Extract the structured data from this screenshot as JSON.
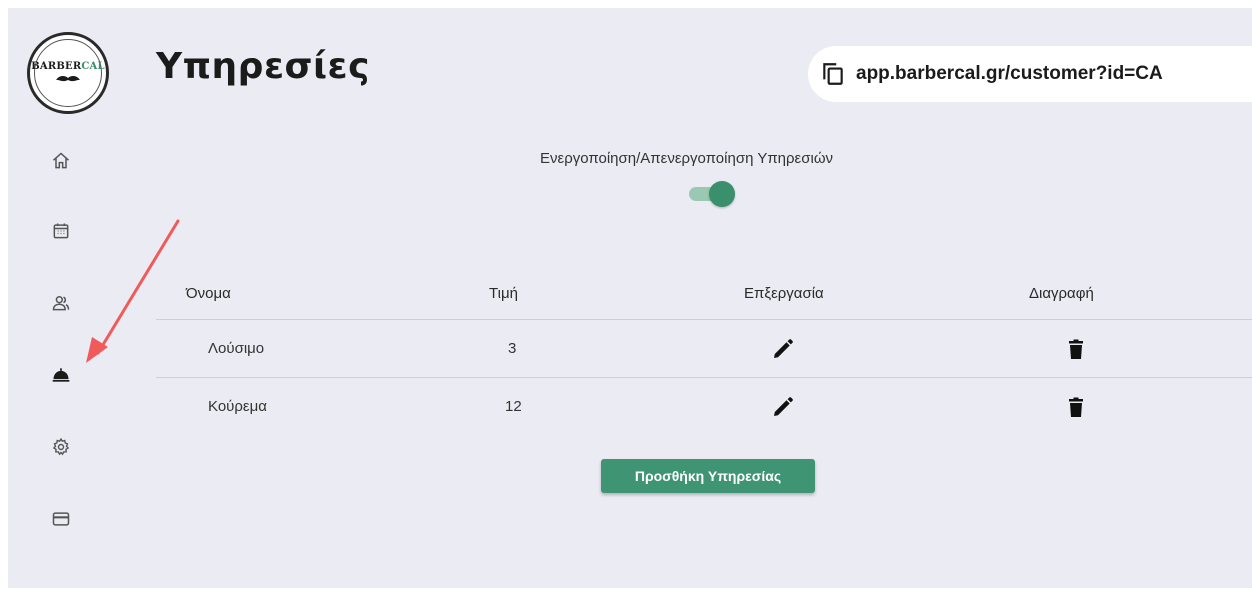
{
  "logo": {
    "text_dark": "BARBER",
    "text_accent": "CAL",
    "icon": "mustache-icon"
  },
  "sidebar": {
    "items": [
      {
        "name": "home",
        "icon": "home-icon"
      },
      {
        "name": "calendar",
        "icon": "calendar-icon"
      },
      {
        "name": "customers",
        "icon": "users-icon"
      },
      {
        "name": "services",
        "icon": "service-bell-icon",
        "active": true
      },
      {
        "name": "settings",
        "icon": "gear-icon"
      },
      {
        "name": "billing",
        "icon": "credit-card-icon"
      }
    ]
  },
  "header": {
    "title": "Υπηρεσίες",
    "url": "app.barbercal.gr/customer?id=CA",
    "copy_icon": "copy-icon"
  },
  "toggle": {
    "label": "Ενεργοποίηση/Απενεργοποίηση Υπηρεσιών",
    "on": true
  },
  "table": {
    "columns": [
      "Όνομα",
      "Τιμή",
      "Επξεργασία",
      "Διαγραφή"
    ],
    "rows": [
      {
        "name": "Λούσιμο",
        "price": "3"
      },
      {
        "name": "Κούρεμα",
        "price": "12"
      }
    ],
    "edit_icon": "pencil-icon",
    "delete_icon": "trash-icon"
  },
  "add_button": {
    "label": "Προσθήκη Υπηρεσίας"
  },
  "colors": {
    "accent": "#3f9473",
    "background": "#ebebf3",
    "annotation_arrow": "#f05a5a"
  }
}
